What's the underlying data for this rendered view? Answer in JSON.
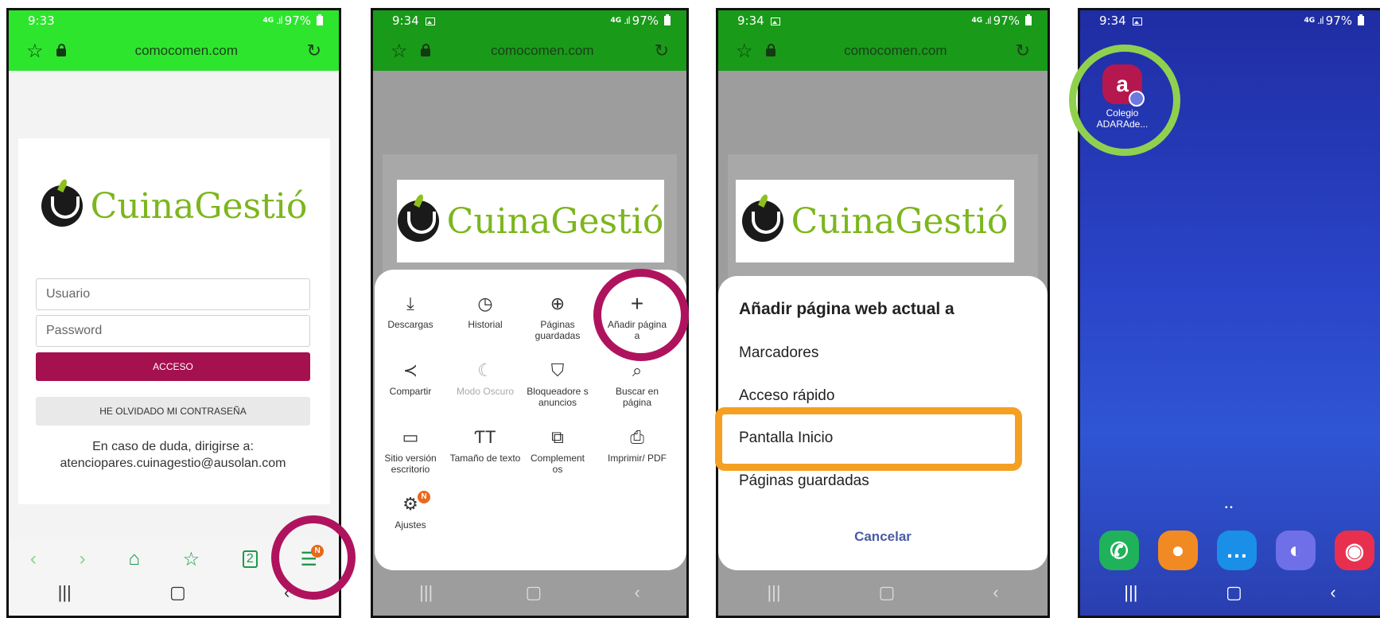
{
  "phone1": {
    "time": "9:33",
    "network": "4G",
    "battery": "97%",
    "url": "comocomen.com",
    "brand_left": "Cuina",
    "brand_right": "Gestió",
    "username_placeholder": "Usuario",
    "password_placeholder": "Password",
    "login_button": "ACCESO",
    "forgot_button": "HE OLVIDADO MI CONTRASEÑA",
    "contact_line1": "En caso de duda, dirigirse a:",
    "contact_line2": "atenciopares.cuinagestio@ausolan.com",
    "menu_badge": "N"
  },
  "phone2": {
    "time": "9:34",
    "network": "4G",
    "battery": "97%",
    "url": "comocomen.com",
    "brand_left": "Cuina",
    "brand_right": "Gestió",
    "menu": [
      {
        "label": "Descargas",
        "icon": "download-icon"
      },
      {
        "label": "Historial",
        "icon": "history-icon"
      },
      {
        "label": "Páginas guardadas",
        "icon": "saved-pages-icon"
      },
      {
        "label": "Añadir página a",
        "icon": "plus-icon"
      },
      {
        "label": "Compartir",
        "icon": "share-icon"
      },
      {
        "label": "Modo Oscuro",
        "icon": "moon-icon"
      },
      {
        "label": "Bloqueadore s anuncios",
        "icon": "shield-icon"
      },
      {
        "label": "Buscar en página",
        "icon": "find-in-page-icon"
      },
      {
        "label": "Sitio versión escritorio",
        "icon": "desktop-icon"
      },
      {
        "label": "Tamaño de texto",
        "icon": "text-size-icon"
      },
      {
        "label": "Complement os",
        "icon": "addons-icon"
      },
      {
        "label": "Imprimir/ PDF",
        "icon": "print-icon"
      },
      {
        "label": "Ajustes",
        "icon": "gear-icon"
      }
    ],
    "settings_badge": "N"
  },
  "phone3": {
    "time": "9:34",
    "network": "4G",
    "battery": "97%",
    "url": "comocomen.com",
    "brand_left": "Cuina",
    "brand_right": "Gestió",
    "dialog_title": "Añadir página web actual a",
    "options": [
      "Marcadores",
      "Acceso rápido",
      "Pantalla Inicio",
      "Páginas guardadas"
    ],
    "cancel": "Cancelar"
  },
  "phone4": {
    "time": "9:34",
    "network": "4G",
    "battery": "97%",
    "app_label_line1": "Colegio",
    "app_label_line2": "ADARAde...",
    "dots": "• •"
  },
  "colors": {
    "highlight_ring": "#b0135e",
    "highlight_rect": "#f5a023",
    "highlight_green": "#8fd14f",
    "login_button": "#a5104f",
    "brand_green": "#7cb61d"
  }
}
